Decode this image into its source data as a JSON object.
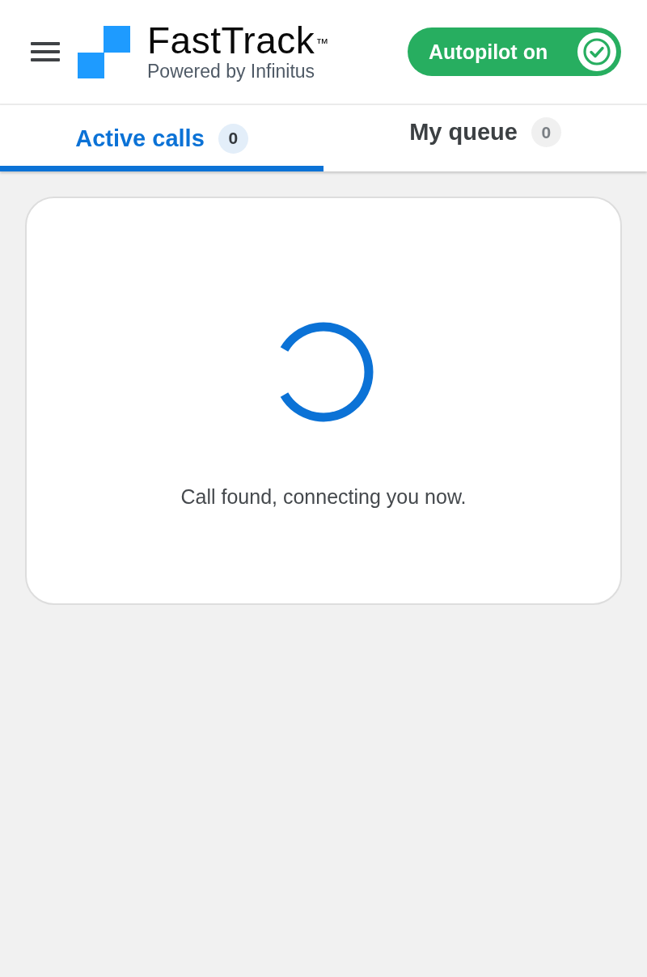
{
  "header": {
    "brand": "FastTrack$^{™}$",
    "tagline": "Powered by Infinitus",
    "autopilot": {
      "label": "Autopilot on",
      "on": true
    }
  },
  "tabs": [
    {
      "label": "Active calls",
      "count": "0",
      "selected": true
    },
    {
      "label": "My queue",
      "count": "0",
      "selected": false
    }
  ],
  "status_card": {
    "message": "Call found, connecting you now."
  }
}
